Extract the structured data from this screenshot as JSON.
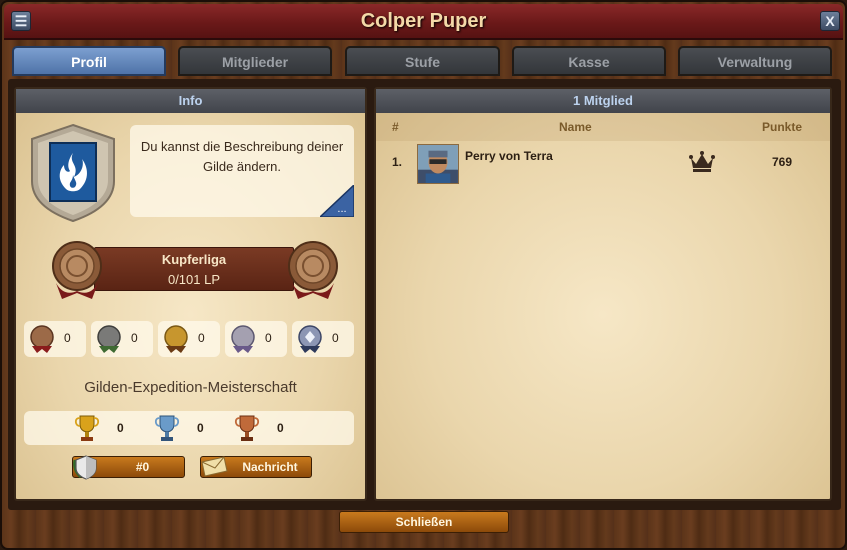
{
  "window": {
    "title": "Colper Puper"
  },
  "titlebar": {
    "menu_icon": "hamburger-icon",
    "close_label": "X"
  },
  "tabs": [
    {
      "label": "Profil",
      "active": true
    },
    {
      "label": "Mitglieder",
      "active": false
    },
    {
      "label": "Stufe",
      "active": false
    },
    {
      "label": "Kasse",
      "active": false
    },
    {
      "label": "Verwaltung",
      "active": false
    }
  ],
  "info": {
    "header": "Info",
    "description": "Du kannst die Beschreibung deiner Gilde ändern.",
    "edit_label": "...",
    "league": {
      "name": "Kupferliga",
      "points": "0/101 LP"
    },
    "badges": [
      {
        "icon": "bronze-wreath-badge-icon",
        "value": "0"
      },
      {
        "icon": "iron-wreath-badge-icon",
        "value": "0"
      },
      {
        "icon": "gold-wreath-badge-icon",
        "value": "0"
      },
      {
        "icon": "silver-wreath-badge-icon",
        "value": "0"
      },
      {
        "icon": "crystal-wreath-badge-icon",
        "value": "0"
      }
    ],
    "expedition_title": "Gilden-Expedition-Meisterschaft",
    "trophies": [
      {
        "icon": "gold-trophy-icon",
        "value": "0",
        "color": "#d9a21b"
      },
      {
        "icon": "silver-trophy-icon",
        "value": "0",
        "color": "#6a9bc9"
      },
      {
        "icon": "bronze-trophy-icon",
        "value": "0",
        "color": "#c06a3a"
      }
    ],
    "rank_button": "#0",
    "message_button": "Nachricht"
  },
  "members": {
    "header": "1 Mitglied",
    "columns": {
      "rank": "#",
      "name": "Name",
      "points": "Punkte"
    },
    "rows": [
      {
        "rank": "1.",
        "name": "Perry von Terra",
        "points": "769",
        "role_icon": "crown-icon"
      }
    ]
  },
  "footer": {
    "close_label": "Schließen"
  },
  "colors": {
    "accent": "#4f73a8",
    "button": "#c97a1d",
    "titlebar": "#7a2020"
  }
}
